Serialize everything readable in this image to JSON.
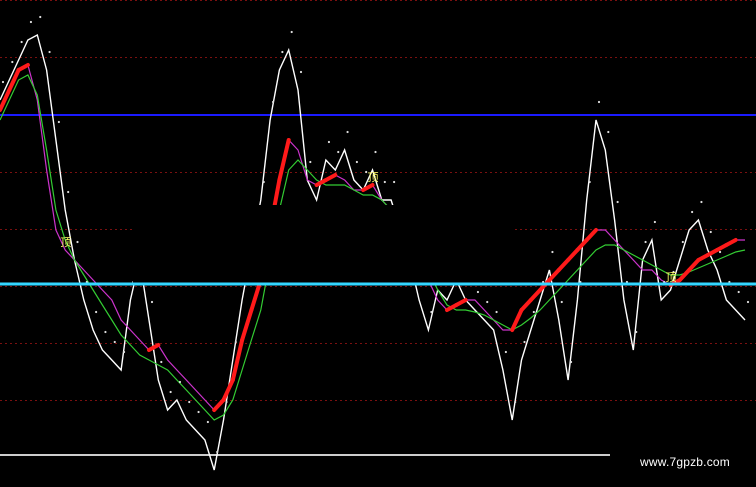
{
  "watermark": "www.7gpzb.com",
  "chart_data": {
    "type": "line",
    "grid": true,
    "x": [
      0,
      1,
      2,
      3,
      4,
      5,
      6,
      7,
      8,
      9,
      10,
      11,
      12,
      13,
      14,
      15,
      16,
      17,
      18,
      19,
      20,
      21,
      22,
      23,
      24,
      25,
      26,
      27,
      28,
      29,
      30,
      31,
      32,
      33,
      34,
      35,
      36,
      37,
      38,
      39,
      40,
      41,
      42,
      43,
      44,
      45,
      46,
      47,
      48,
      49,
      50,
      51,
      52,
      53,
      54,
      55,
      56,
      57,
      58,
      59,
      60,
      61,
      62,
      63,
      64,
      65,
      66,
      67,
      68,
      69,
      70,
      71,
      72,
      73,
      74,
      75,
      76,
      77,
      78,
      79,
      80
    ],
    "ylim": [
      0,
      487
    ],
    "hlines": [
      {
        "level": 115,
        "color": "#1a1aff"
      },
      {
        "level": 284,
        "color": "#33d6ff"
      },
      {
        "level": 455,
        "color": "#cccccc"
      }
    ],
    "series": [
      {
        "color": "#ffffff",
        "values": [
          100,
          80,
          60,
          40,
          35,
          70,
          140,
          210,
          260,
          300,
          330,
          350,
          360,
          370,
          300,
          260,
          320,
          380,
          410,
          400,
          420,
          430,
          440,
          470,
          420,
          360,
          300,
          250,
          200,
          120,
          70,
          50,
          90,
          180,
          200,
          160,
          170,
          150,
          180,
          190,
          170,
          200,
          200,
          230,
          260,
          300,
          330,
          290,
          300,
          280,
          300,
          310,
          320,
          330,
          370,
          420,
          360,
          330,
          300,
          270,
          320,
          380,
          300,
          200,
          120,
          150,
          220,
          300,
          350,
          260,
          240,
          300,
          290,
          260,
          230,
          220,
          250,
          270,
          300,
          310,
          320
        ]
      },
      {
        "color": "#cc33cc",
        "values": [
          110,
          90,
          70,
          65,
          100,
          170,
          230,
          250,
          260,
          270,
          280,
          290,
          300,
          320,
          330,
          340,
          350,
          345,
          360,
          370,
          380,
          390,
          400,
          410,
          400,
          380,
          340,
          310,
          280,
          230,
          180,
          140,
          150,
          180,
          185,
          180,
          175,
          180,
          190,
          190,
          185,
          200,
          210,
          220,
          240,
          260,
          280,
          300,
          310,
          305,
          300,
          300,
          310,
          320,
          330,
          330,
          310,
          300,
          290,
          280,
          270,
          260,
          250,
          240,
          230,
          230,
          240,
          250,
          260,
          270,
          270,
          280,
          285,
          280,
          270,
          260,
          255,
          250,
          245,
          240,
          240
        ]
      },
      {
        "color": "#33cc33",
        "values": [
          120,
          100,
          80,
          75,
          95,
          150,
          210,
          240,
          260,
          275,
          290,
          305,
          320,
          335,
          345,
          355,
          360,
          365,
          370,
          380,
          390,
          400,
          410,
          420,
          415,
          400,
          370,
          340,
          310,
          260,
          210,
          170,
          160,
          170,
          180,
          185,
          185,
          185,
          190,
          195,
          195,
          200,
          210,
          220,
          235,
          250,
          270,
          290,
          305,
          310,
          310,
          312,
          315,
          320,
          325,
          330,
          325,
          318,
          310,
          300,
          290,
          280,
          270,
          260,
          250,
          245,
          245,
          250,
          255,
          260,
          265,
          270,
          275,
          275,
          272,
          268,
          264,
          260,
          256,
          252,
          250
        ]
      }
    ],
    "markers": [
      {
        "x": 7,
        "label": "顶",
        "color": "#ffff66"
      },
      {
        "x": 40,
        "label": "顶",
        "color": "#ffff66"
      },
      {
        "x": 72,
        "label": "顶",
        "color": "#ffff66"
      }
    ]
  }
}
